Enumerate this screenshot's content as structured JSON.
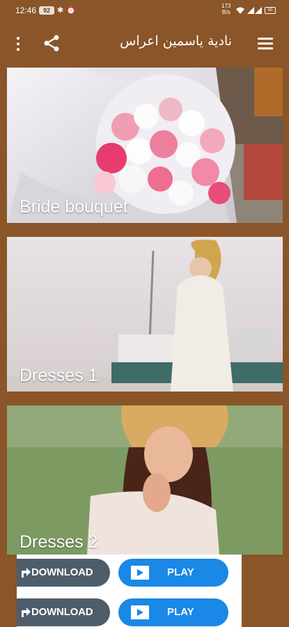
{
  "status_bar": {
    "time": "12:46",
    "badge": "92",
    "speed_value": "173",
    "speed_unit": "B/s",
    "battery": "80"
  },
  "toolbar": {
    "title": "نادية ياسمين اعراس"
  },
  "cards": [
    {
      "label": "Bride bouquet"
    },
    {
      "label": "Dresses 1"
    },
    {
      "label": "Dresses 2"
    }
  ],
  "ad": {
    "rows": [
      {
        "download": "DOWNLOAD",
        "play": "PLAY"
      },
      {
        "download": "DOWNLOAD",
        "play": "PLAY"
      }
    ]
  },
  "colors": {
    "primary": "#8a5528",
    "play_button": "#1a88e6",
    "download_button": "#4e5d6a"
  }
}
